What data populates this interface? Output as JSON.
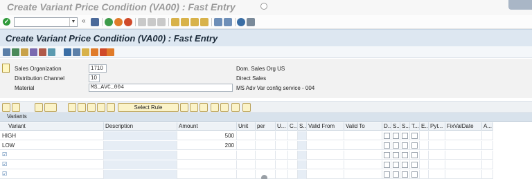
{
  "window": {
    "title": "Create Variant Price Condition (VA00) : Fast Entry"
  },
  "toolbar": {
    "command_field_value": "",
    "icons": [
      "enter-icon",
      "back-chevron-icon",
      "save-icon",
      "back-icon",
      "exit-icon",
      "cancel-icon",
      "print-icon",
      "find-icon",
      "find-next-icon",
      "first-page-icon",
      "previous-page-icon",
      "next-page-icon",
      "last-page-icon",
      "new-session-icon",
      "shortcut-icon",
      "help-icon",
      "layout-icon"
    ]
  },
  "header": {
    "title": "Create Variant Price Condition (VA00) : Fast Entry"
  },
  "fields": [
    {
      "label": "Sales Organization",
      "value": "1710",
      "description": "Dom. Sales Org US"
    },
    {
      "label": "Distribution Channel",
      "value": "10",
      "description": "Direct Sales"
    },
    {
      "label": "Material",
      "value": "MS_AVC_004",
      "description": "MS Adv Var config service - 004"
    }
  ],
  "table_toolbar": {
    "select_rule_label": "Select Rule"
  },
  "variants": {
    "title": "Variants",
    "columns": [
      "Variant",
      "Description",
      "Amount",
      "Unit",
      "per",
      "U...",
      "C...",
      "S...",
      "Valid From",
      "Valid To",
      "D...",
      "S...",
      "S...",
      "T...",
      "E...",
      "Pyt...",
      "FixValDate",
      "A..."
    ],
    "rows": [
      {
        "variant": "HIGH",
        "description": "",
        "amount": "500"
      },
      {
        "variant": "LOW",
        "description": "",
        "amount": "200"
      },
      {
        "variant": "",
        "description": "",
        "amount": ""
      },
      {
        "variant": "",
        "description": "",
        "amount": ""
      },
      {
        "variant": "",
        "description": "",
        "amount": ""
      }
    ]
  },
  "colors": {
    "header_bg": "#dde7f1",
    "grid_title_bg": "#d8e2ec",
    "button_bg": "#fbf3c8",
    "accent_green": "#2f9a3a"
  }
}
